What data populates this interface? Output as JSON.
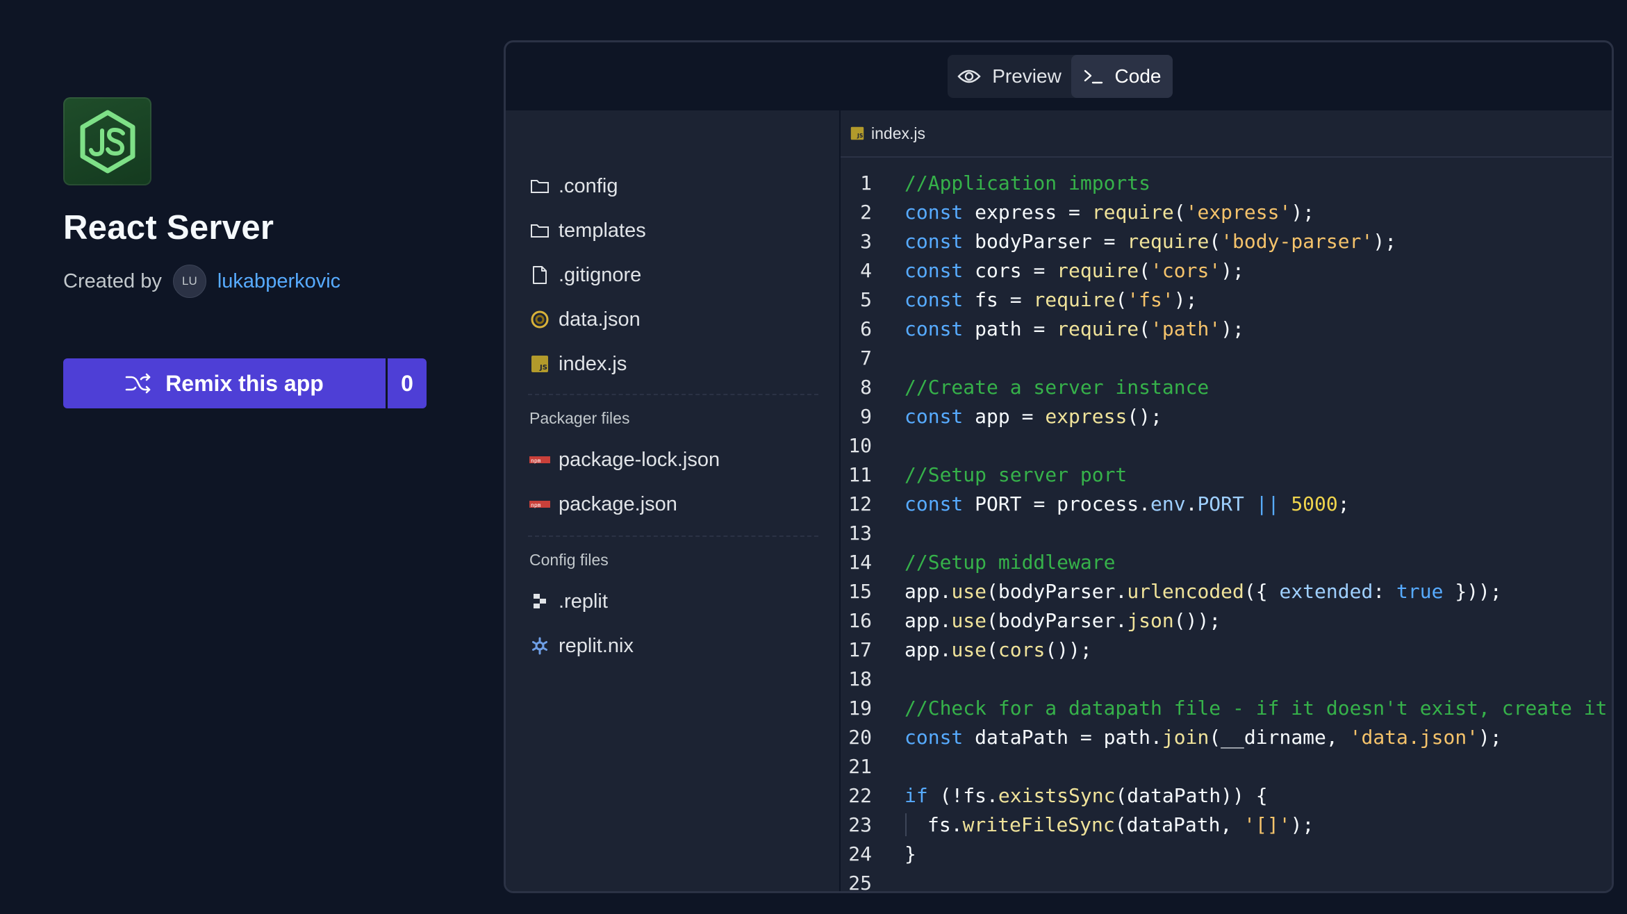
{
  "app": {
    "title": "React Server",
    "created_by_label": "Created by",
    "avatar_initials": "LU",
    "username": "lukabperkovic",
    "icon": "nodejs-logo-icon"
  },
  "remix": {
    "label": "Remix this app",
    "count": "0",
    "icon": "shuffle-icon"
  },
  "view_toggle": {
    "preview_label": "Preview",
    "code_label": "Code",
    "selected": "Code"
  },
  "explorer": {
    "files": [
      {
        "name": ".config",
        "icon": "folder-icon"
      },
      {
        "name": "templates",
        "icon": "folder-icon"
      },
      {
        "name": ".gitignore",
        "icon": "file-icon"
      },
      {
        "name": "data.json",
        "icon": "json-icon"
      },
      {
        "name": "index.js",
        "icon": "js-file-icon"
      }
    ],
    "packager_label": "Packager files",
    "packager_files": [
      {
        "name": "package-lock.json",
        "icon": "npm-icon"
      },
      {
        "name": "package.json",
        "icon": "npm-icon"
      }
    ],
    "config_label": "Config files",
    "config_files": [
      {
        "name": ".replit",
        "icon": "replit-icon"
      },
      {
        "name": "replit.nix",
        "icon": "nix-icon"
      }
    ]
  },
  "editor": {
    "open_file": "index.js",
    "lines": [
      "//Application imports",
      "const express = require('express');",
      "const bodyParser = require('body-parser');",
      "const cors = require('cors');",
      "const fs = require('fs');",
      "const path = require('path');",
      "",
      "//Create a server instance",
      "const app = express();",
      "",
      "//Setup server port",
      "const PORT = process.env.PORT || 5000;",
      "",
      "//Setup middleware",
      "app.use(bodyParser.urlencoded({ extended: true }));",
      "app.use(bodyParser.json());",
      "app.use(cors());",
      "",
      "//Check for a datapath file - if it doesn't exist, create it",
      "const dataPath = path.join(__dirname, 'data.json');",
      "",
      "if (!fs.existsSync(dataPath)) {",
      "  fs.writeFileSync(dataPath, '[]');",
      "}",
      ""
    ]
  },
  "colors": {
    "background": "#0e1525",
    "panel": "#1c2333",
    "accent": "#4e3fd6",
    "link": "#57abff",
    "comment": "#36b24a",
    "keyword": "#57abff",
    "function": "#f0e39a",
    "string": "#f5c36b"
  }
}
